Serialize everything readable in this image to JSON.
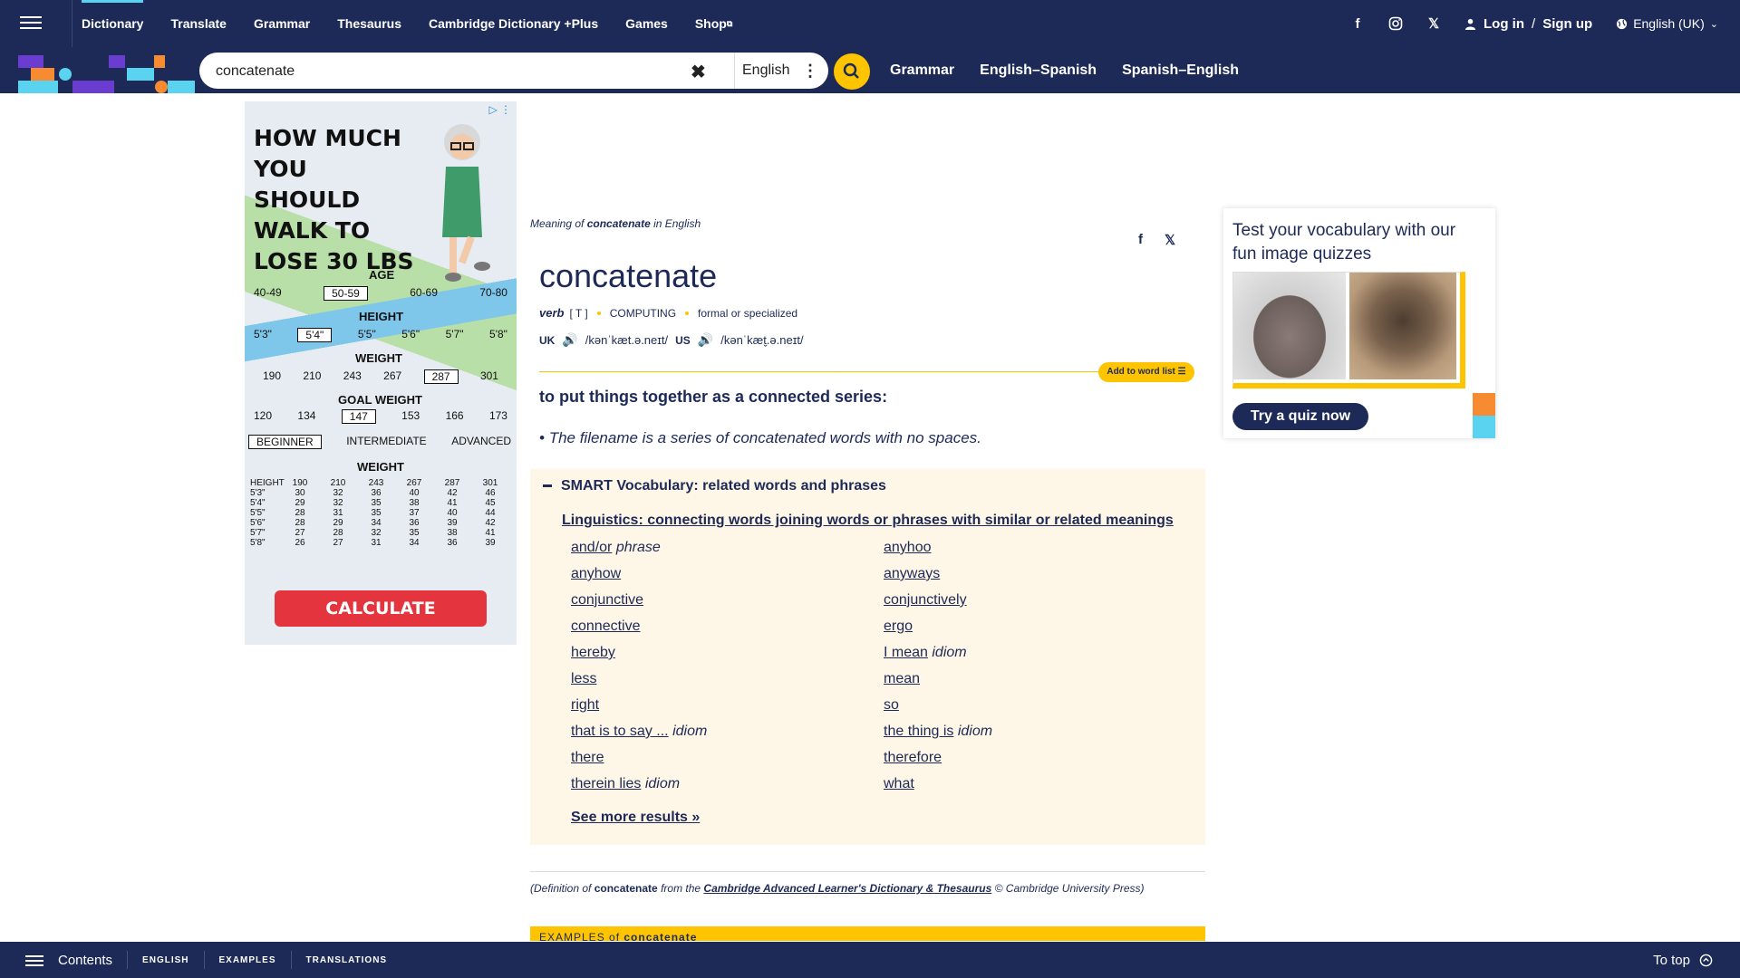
{
  "topnav": {
    "items": [
      "Dictionary",
      "Translate",
      "Grammar",
      "Thesaurus",
      "Cambridge Dictionary +Plus",
      "Games",
      "Shop"
    ],
    "login": "Log in",
    "signup_sep": "/",
    "signup": "Sign up",
    "language": "English (UK)"
  },
  "search": {
    "value": "concatenate",
    "language": "English",
    "quick_links": [
      "Grammar",
      "English–Spanish",
      "Spanish–English"
    ]
  },
  "ad": {
    "headline": "HOW MUCH YOU SHOULD WALK TO LOSE 30 LBS",
    "age_label": "AGE",
    "ages": [
      "40-49",
      "50-59",
      "60-69",
      "70-80"
    ],
    "height_label": "HEIGHT",
    "heights": [
      "5'3\"",
      "5'4\"",
      "5'5\"",
      "5'6\"",
      "5'7\"",
      "5'8\""
    ],
    "weight_label": "WEIGHT",
    "weights": [
      "190",
      "210",
      "243",
      "267",
      "287",
      "301"
    ],
    "goal_label": "GOAL WEIGHT",
    "goals": [
      "120",
      "134",
      "147",
      "153",
      "166",
      "173"
    ],
    "levels": [
      "BEGINNER",
      "INTERMEDIATE",
      "ADVANCED"
    ],
    "table_title": "WEIGHT",
    "table_header": [
      "HEIGHT",
      "190",
      "210",
      "243",
      "267",
      "287",
      "301"
    ],
    "table_rows": [
      [
        "5'3\"",
        "30",
        "32",
        "36",
        "40",
        "42",
        "46"
      ],
      [
        "5'4\"",
        "29",
        "32",
        "35",
        "38",
        "41",
        "45"
      ],
      [
        "5'5\"",
        "28",
        "31",
        "35",
        "37",
        "40",
        "44"
      ],
      [
        "5'6\"",
        "28",
        "29",
        "34",
        "36",
        "39",
        "42"
      ],
      [
        "5'7\"",
        "27",
        "28",
        "32",
        "35",
        "38",
        "41"
      ],
      [
        "5'8\"",
        "26",
        "27",
        "31",
        "34",
        "36",
        "39"
      ]
    ],
    "cta": "CALCULATE"
  },
  "entry": {
    "meaning_prefix": "Meaning of ",
    "meaning_word": "concatenate",
    "meaning_suffix": " in English",
    "headword": "concatenate",
    "pos": "verb",
    "grammar": "[ T ]",
    "domain": "COMPUTING",
    "register": "formal or specialized",
    "uk_label": "UK",
    "uk_pron": "/kənˈkæt.ə.neɪt/",
    "us_label": "US",
    "us_pron": "/kənˈkæt̬.ə.neɪt/",
    "wordlist_btn": "Add to word list",
    "definition": "to put things together as a connected series:",
    "example": "The filename is a series of concatenated words with no spaces."
  },
  "smart": {
    "title": "SMART Vocabulary: related words and phrases",
    "topic": "Linguistics: connecting words joining words or phrases with similar or related meanings",
    "left": [
      {
        "w": "and/or",
        "tag": "phrase"
      },
      {
        "w": "anyhow",
        "tag": ""
      },
      {
        "w": "conjunctive",
        "tag": ""
      },
      {
        "w": "connective",
        "tag": ""
      },
      {
        "w": "hereby",
        "tag": ""
      },
      {
        "w": "less",
        "tag": ""
      },
      {
        "w": "right",
        "tag": ""
      },
      {
        "w": "that is to say ...",
        "tag": "idiom"
      },
      {
        "w": "there",
        "tag": ""
      },
      {
        "w": "therein lies",
        "tag": "idiom"
      }
    ],
    "right": [
      {
        "w": "anyhoo",
        "tag": ""
      },
      {
        "w": "anyways",
        "tag": ""
      },
      {
        "w": "conjunctively",
        "tag": ""
      },
      {
        "w": "ergo",
        "tag": ""
      },
      {
        "w": "I mean",
        "tag": "idiom"
      },
      {
        "w": "mean",
        "tag": ""
      },
      {
        "w": "so",
        "tag": ""
      },
      {
        "w": "the thing is",
        "tag": "idiom"
      },
      {
        "w": "therefore",
        "tag": ""
      },
      {
        "w": "what",
        "tag": ""
      }
    ],
    "see_more": "See more results »"
  },
  "credit": {
    "prefix": "(Definition of ",
    "word": "concatenate",
    "middle": " from the ",
    "source": "Cambridge Advanced Learner's Dictionary & Thesaurus",
    "suffix": " © Cambridge University Press)"
  },
  "examples_bar": {
    "prefix": "EXAMPLES of ",
    "word": "concatenate"
  },
  "quiz": {
    "title": "Test your vocabulary with our fun image quizzes",
    "button": "Try a quiz now"
  },
  "bottombar": {
    "contents": "Contents",
    "links": [
      "ENGLISH",
      "EXAMPLES",
      "TRANSLATIONS"
    ],
    "totop": "To top"
  },
  "colors": {
    "navy": "#1d2a57",
    "yellow": "#fec400",
    "cyan": "#5ad3f0",
    "orange": "#f68b31",
    "purple": "#6a3cd0"
  }
}
